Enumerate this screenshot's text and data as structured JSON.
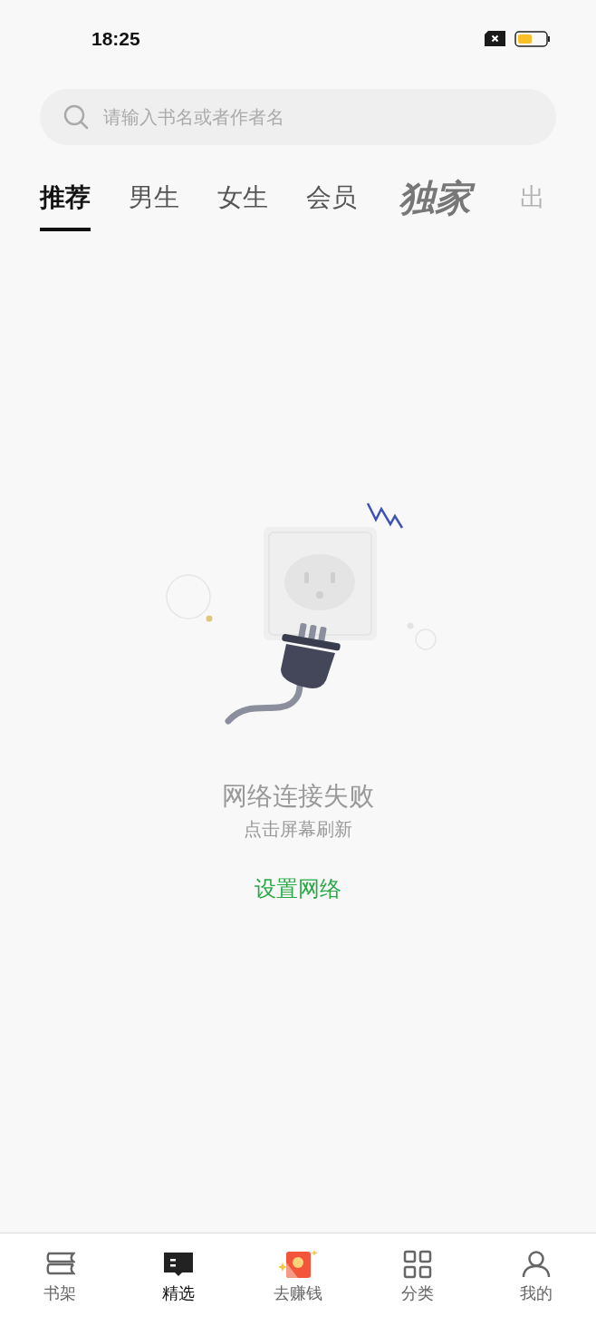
{
  "status_bar": {
    "time": "18:25"
  },
  "search": {
    "placeholder": "请输入书名或者作者名"
  },
  "tabs": [
    {
      "label": "推荐",
      "selected": true,
      "kind": "text"
    },
    {
      "label": "男生",
      "selected": false,
      "kind": "text"
    },
    {
      "label": "女生",
      "selected": false,
      "kind": "text"
    },
    {
      "label": "会员",
      "selected": false,
      "kind": "text"
    },
    {
      "label": "独家",
      "selected": false,
      "kind": "logo"
    },
    {
      "label": "出",
      "selected": false,
      "kind": "faded"
    }
  ],
  "error": {
    "title": "网络连接失败",
    "hint": "点击屏幕刷新",
    "action": "设置网络"
  },
  "nav": [
    {
      "label": "书架",
      "selected": false,
      "kind": "shelf"
    },
    {
      "label": "精选",
      "selected": true,
      "kind": "book"
    },
    {
      "label": "去赚钱",
      "selected": false,
      "kind": "packet"
    },
    {
      "label": "分类",
      "selected": false,
      "kind": "grid"
    },
    {
      "label": "我的",
      "selected": false,
      "kind": "person"
    }
  ]
}
